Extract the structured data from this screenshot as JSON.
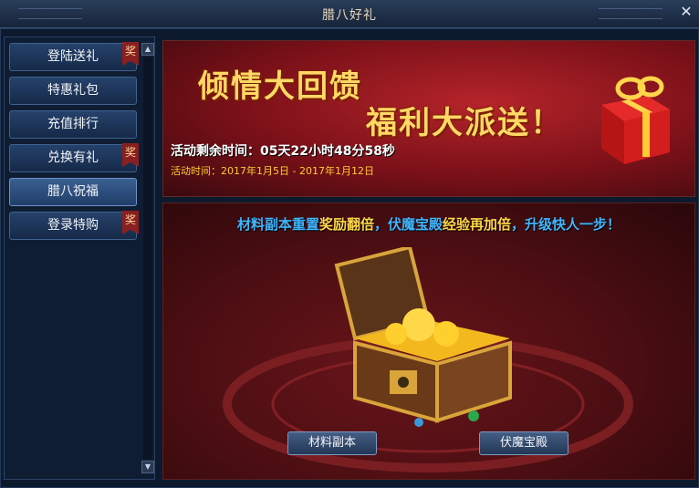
{
  "window": {
    "title": "腊八好礼",
    "close_glyph": "✕"
  },
  "sidebar": {
    "items": [
      {
        "label": "登陆送礼",
        "badge": "奖"
      },
      {
        "label": "特惠礼包",
        "badge": ""
      },
      {
        "label": "充值排行",
        "badge": ""
      },
      {
        "label": "兑换有礼",
        "badge": "奖"
      },
      {
        "label": "腊八祝福",
        "badge": "",
        "active": true
      },
      {
        "label": "登录特购",
        "badge": "奖"
      }
    ]
  },
  "banner": {
    "headline1": "倾情大回馈",
    "headline2": "福利大派送！",
    "countdown": "活动剩余时间：05天22小时48分58秒",
    "date_range": "活动时间：2017年1月5日 - 2017年1月12日"
  },
  "panel": {
    "desc_parts": [
      "材料副本重置",
      "奖励翻倍",
      "，伏魔宝殿",
      "经验再加倍",
      "，升级快人一步！"
    ],
    "button_left": "材料副本",
    "button_right": "伏魔宝殿"
  },
  "colors": {
    "accent_gold": "#ffd866",
    "accent_blue": "#41b6ff",
    "badge_red": "#8a1f1f"
  }
}
